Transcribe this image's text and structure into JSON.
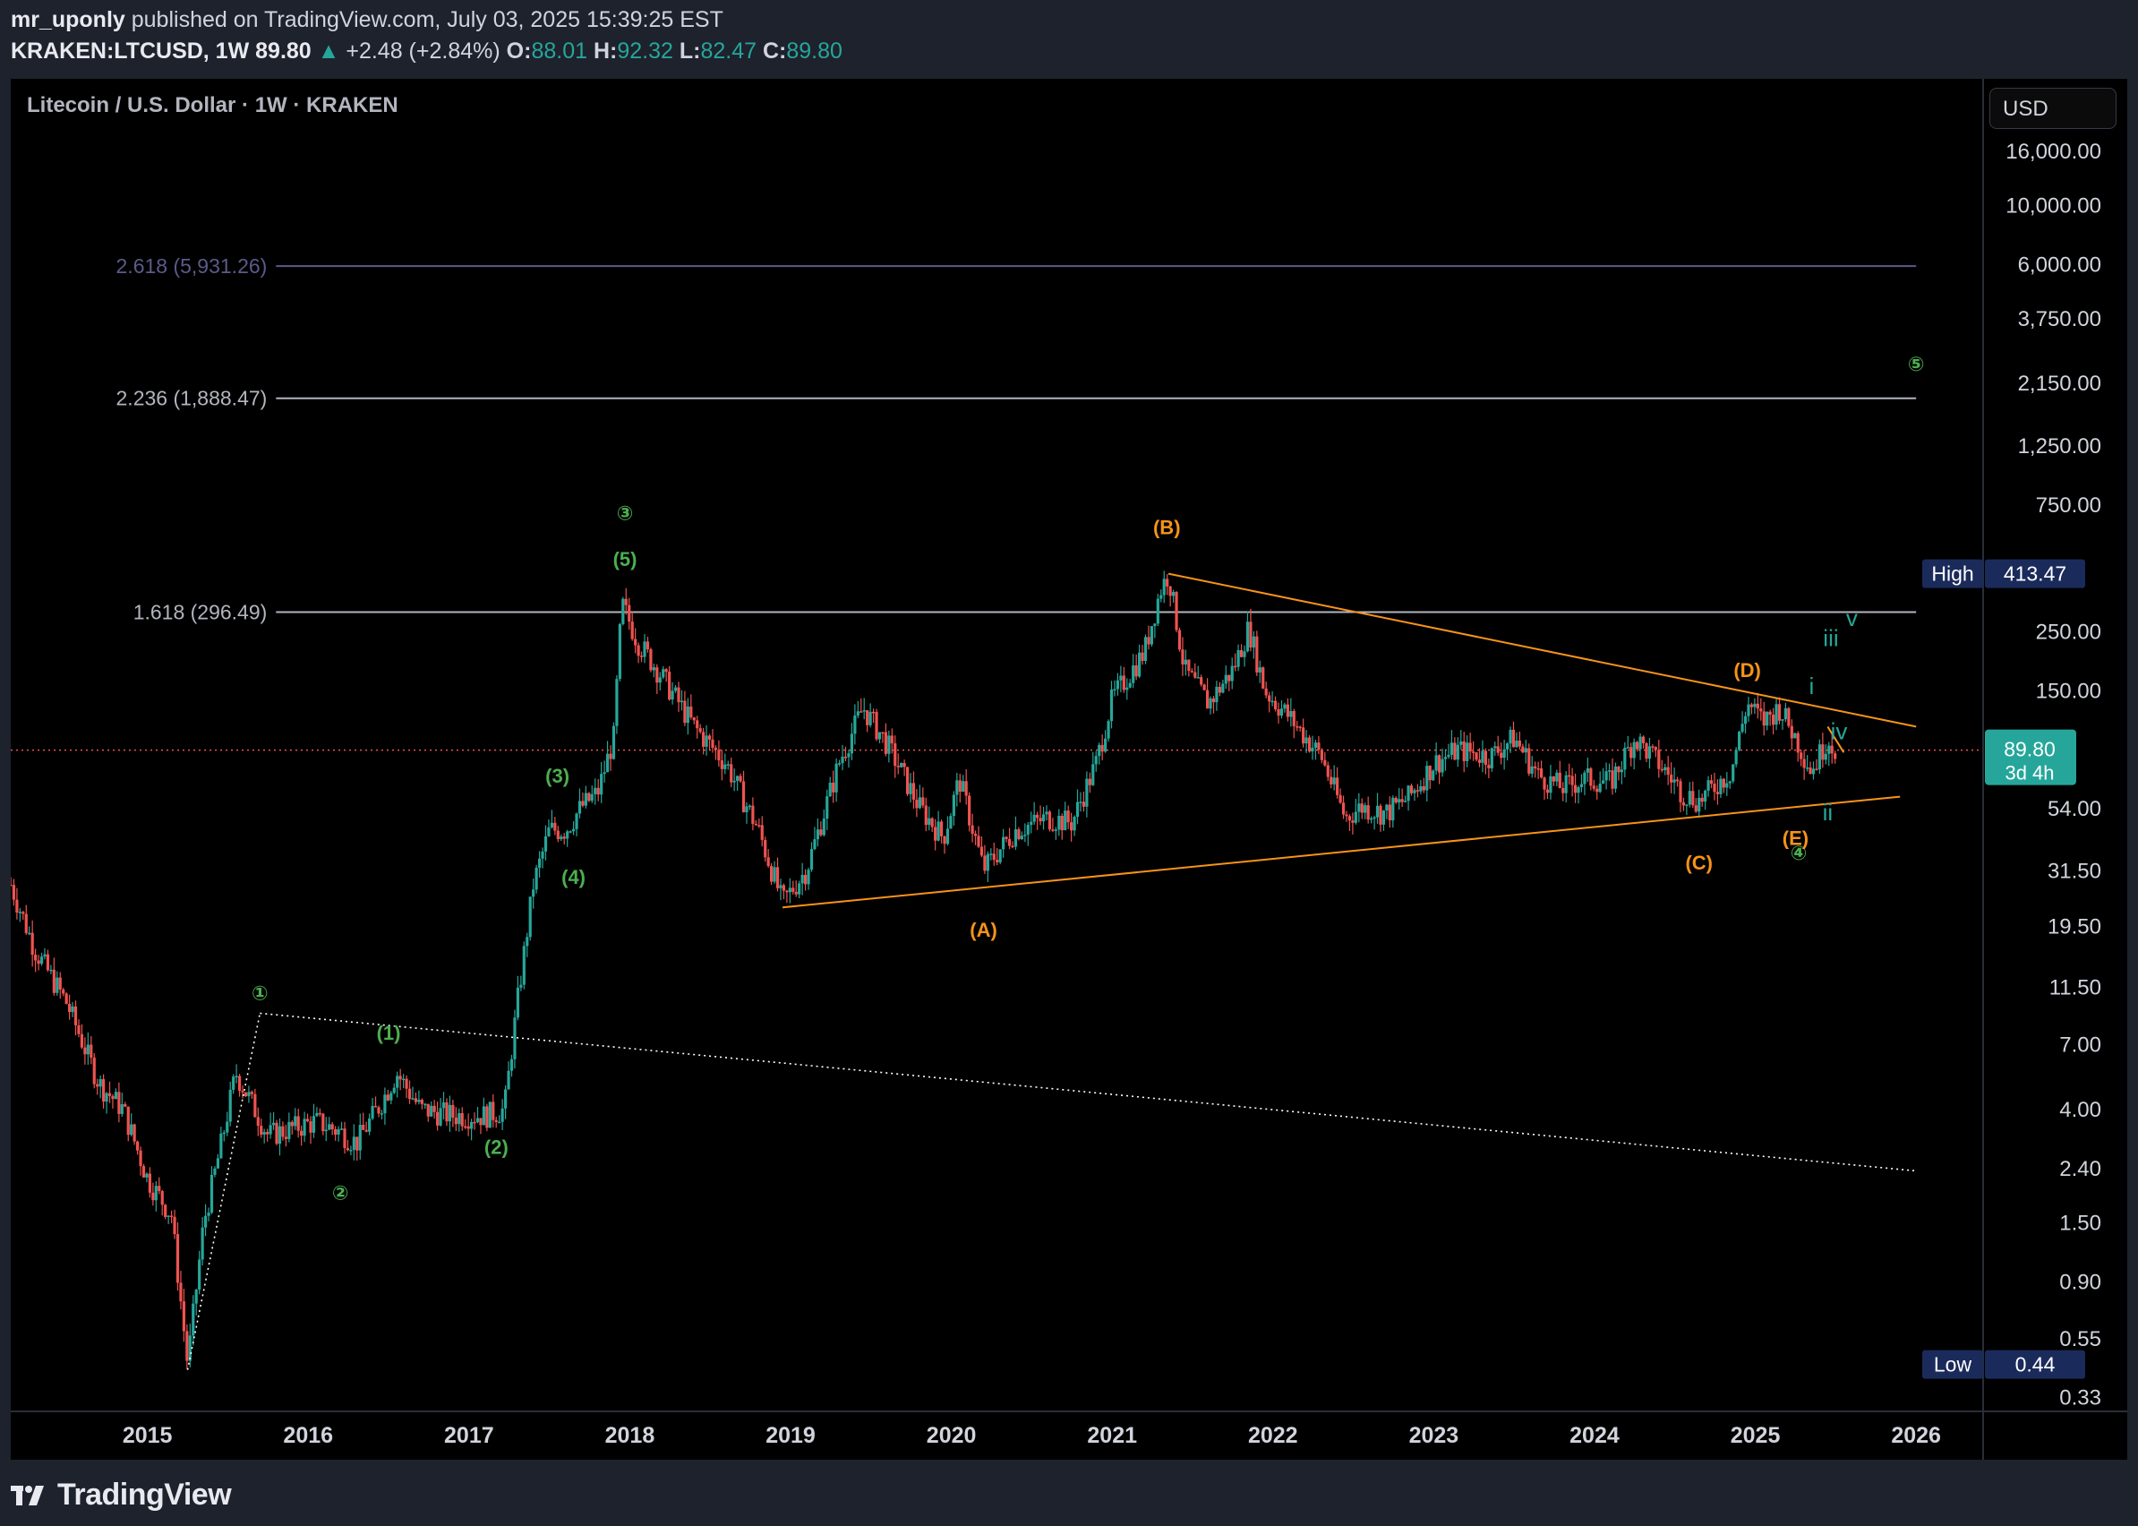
{
  "header": {
    "publisher": "mr_uponly",
    "published_text": "published on TradingView.com, July 03, 2025 15:39:25 EST",
    "symbol": "KRAKEN:LTCUSD, 1W",
    "last": "89.80",
    "change": "+2.48 (+2.84%)",
    "o_label": "O:",
    "o_value": "88.01",
    "h_label": "H:",
    "h_value": "92.32",
    "l_label": "L:",
    "l_value": "82.47",
    "c_label": "C:",
    "c_value": "89.80"
  },
  "footer": {
    "brand": "TradingView"
  },
  "colors": {
    "up": "#26a69a",
    "down": "#ef5350",
    "triangle": "#f7931a",
    "wave_green": "#4caf50",
    "roman_teal": "#26a69a",
    "fib_top": "#5b5a8a",
    "fib": "#b2b5be"
  },
  "chart_data": {
    "type": "candlestick",
    "title": "Litecoin / U.S. Dollar · 1W · KRAKEN",
    "currency": "USD",
    "scale": "log",
    "ylim": [
      0.3,
      22000
    ],
    "xlim": [
      2014.15,
      2026.4
    ],
    "y_ticks": [
      "16,000.00",
      "10,000.00",
      "6,000.00",
      "3,750.00",
      "2,150.00",
      "1,250.00",
      "750.00",
      "250.00",
      "150.00",
      "54.00",
      "31.50",
      "19.50",
      "11.50",
      "7.00",
      "4.00",
      "2.40",
      "1.50",
      "0.90",
      "0.55",
      "0.33"
    ],
    "x_ticks": [
      "2015",
      "2016",
      "2017",
      "2018",
      "2019",
      "2020",
      "2021",
      "2022",
      "2023",
      "2024",
      "2025",
      "2026"
    ],
    "price_series": {
      "name": "KRAKEN:LTCUSD",
      "points": [
        [
          2014.15,
          28
        ],
        [
          2014.3,
          16
        ],
        [
          2014.5,
          10
        ],
        [
          2014.7,
          5
        ],
        [
          2014.85,
          4.0
        ],
        [
          2015.0,
          2.2
        ],
        [
          2015.15,
          1.6
        ],
        [
          2015.25,
          0.44
        ],
        [
          2015.35,
          1.5
        ],
        [
          2015.45,
          2.8
        ],
        [
          2015.55,
          5.5
        ],
        [
          2015.65,
          4.2
        ],
        [
          2015.75,
          3.2
        ],
        [
          2015.9,
          3.4
        ],
        [
          2016.05,
          3.6
        ],
        [
          2016.2,
          3.3
        ],
        [
          2016.3,
          3.0
        ],
        [
          2016.45,
          4.2
        ],
        [
          2016.55,
          5.5
        ],
        [
          2016.7,
          4.0
        ],
        [
          2016.9,
          3.8
        ],
        [
          2017.1,
          3.8
        ],
        [
          2017.22,
          4.0
        ],
        [
          2017.3,
          10
        ],
        [
          2017.4,
          28
        ],
        [
          2017.5,
          45
        ],
        [
          2017.6,
          45
        ],
        [
          2017.7,
          55
        ],
        [
          2017.8,
          62
        ],
        [
          2017.9,
          100
        ],
        [
          2017.95,
          320
        ],
        [
          2018.05,
          230
        ],
        [
          2018.2,
          170
        ],
        [
          2018.4,
          110
        ],
        [
          2018.6,
          80
        ],
        [
          2018.8,
          45
        ],
        [
          2018.95,
          24
        ],
        [
          2019.1,
          32
        ],
        [
          2019.3,
          80
        ],
        [
          2019.45,
          130
        ],
        [
          2019.6,
          95
        ],
        [
          2019.8,
          55
        ],
        [
          2019.95,
          42
        ],
        [
          2020.05,
          70
        ],
        [
          2020.2,
          32
        ],
        [
          2020.4,
          45
        ],
        [
          2020.6,
          50
        ],
        [
          2020.75,
          48
        ],
        [
          2020.9,
          80
        ],
        [
          2021.0,
          140
        ],
        [
          2021.2,
          210
        ],
        [
          2021.3,
          360
        ],
        [
          2021.35,
          413.47
        ],
        [
          2021.45,
          180
        ],
        [
          2021.6,
          135
        ],
        [
          2021.75,
          180
        ],
        [
          2021.85,
          260
        ],
        [
          2021.95,
          150
        ],
        [
          2022.1,
          120
        ],
        [
          2022.3,
          85
        ],
        [
          2022.45,
          50
        ],
        [
          2022.55,
          55
        ],
        [
          2022.7,
          52
        ],
        [
          2022.85,
          60
        ],
        [
          2023.0,
          80
        ],
        [
          2023.15,
          90
        ],
        [
          2023.35,
          85
        ],
        [
          2023.5,
          100
        ],
        [
          2023.65,
          72
        ],
        [
          2023.8,
          65
        ],
        [
          2023.95,
          70
        ],
        [
          2024.1,
          68
        ],
        [
          2024.25,
          100
        ],
        [
          2024.4,
          80
        ],
        [
          2024.55,
          62
        ],
        [
          2024.65,
          58
        ],
        [
          2024.85,
          75
        ],
        [
          2024.95,
          135
        ],
        [
          2025.05,
          115
        ],
        [
          2025.15,
          130
        ],
        [
          2025.25,
          100
        ],
        [
          2025.35,
          75
        ],
        [
          2025.45,
          100
        ],
        [
          2025.5,
          89.8
        ]
      ]
    },
    "last_price": {
      "value": 89.8,
      "price_label": "89.80",
      "countdown": "3d 4h"
    },
    "high": {
      "label": "High",
      "value": 413.47,
      "text": "413.47"
    },
    "low": {
      "label": "Low",
      "value": 0.44,
      "text": "0.44"
    },
    "fib_levels": [
      {
        "label": "2.618 (5,931.26)",
        "value": 5931.26,
        "x_start": 2015.8,
        "x_end": 2026.0,
        "color": "#5b5a8a"
      },
      {
        "label": "2.236 (1,888.47)",
        "value": 1888.47,
        "x_start": 2015.8,
        "x_end": 2026.0,
        "color": "#b2b5be"
      },
      {
        "label": "1.618 (296.49)",
        "value": 296.49,
        "x_start": 2015.8,
        "x_end": 2026.0,
        "color": "#b2b5be"
      }
    ],
    "trendlines": [
      {
        "role": "triangle upper",
        "from": [
          2021.35,
          413.47
        ],
        "to": [
          2026.0,
          110
        ],
        "style": "solid",
        "color": "#f7931a"
      },
      {
        "role": "triangle lower",
        "from": [
          2018.95,
          23
        ],
        "to": [
          2025.9,
          60
        ],
        "style": "solid",
        "color": "#f7931a"
      },
      {
        "role": "dotted channel",
        "from": [
          2015.7,
          9.2
        ],
        "to": [
          2026.0,
          2.35
        ],
        "style": "dotted",
        "color": "#ffffff"
      },
      {
        "role": "dotted channel",
        "from": [
          2015.25,
          0.42
        ],
        "to": [
          2015.7,
          9.2
        ],
        "style": "dotted",
        "color": "#ffffff"
      },
      {
        "role": "wave v projection",
        "from": [
          2025.45,
          110
        ],
        "to": [
          2025.55,
          88
        ],
        "style": "solid",
        "color": "#f7931a"
      }
    ],
    "wave_labels": [
      {
        "text": "①",
        "x": 2015.7,
        "y": 11.0,
        "color": "#4caf50"
      },
      {
        "text": "②",
        "x": 2016.2,
        "y": 1.95,
        "color": "#4caf50"
      },
      {
        "text": "③",
        "x": 2017.97,
        "y": 700,
        "color": "#4caf50"
      },
      {
        "text": "④",
        "x": 2025.27,
        "y": 37,
        "color": "#4caf50"
      },
      {
        "text": "⑤",
        "x": 2026.0,
        "y": 2550,
        "color": "#4caf50"
      },
      {
        "text": "(1)",
        "x": 2016.5,
        "y": 7.8,
        "color": "#4caf50"
      },
      {
        "text": "(2)",
        "x": 2017.17,
        "y": 2.9,
        "color": "#4caf50"
      },
      {
        "text": "(3)",
        "x": 2017.55,
        "y": 72,
        "color": "#4caf50"
      },
      {
        "text": "(4)",
        "x": 2017.65,
        "y": 30,
        "color": "#4caf50"
      },
      {
        "text": "(5)",
        "x": 2017.97,
        "y": 470,
        "color": "#4caf50"
      },
      {
        "text": "(A)",
        "x": 2020.2,
        "y": 19.0,
        "color": "#f7931a"
      },
      {
        "text": "(B)",
        "x": 2021.34,
        "y": 620,
        "color": "#f7931a"
      },
      {
        "text": "(C)",
        "x": 2024.65,
        "y": 34,
        "color": "#f7931a"
      },
      {
        "text": "(D)",
        "x": 2024.95,
        "y": 180,
        "color": "#f7931a"
      },
      {
        "text": "(E)",
        "x": 2025.25,
        "y": 42,
        "color": "#f7931a"
      }
    ],
    "roman_labels": [
      {
        "text": "i",
        "x": 2025.35,
        "y": 155,
        "color": "#26a69a"
      },
      {
        "text": "ii",
        "x": 2025.45,
        "y": 52,
        "color": "#26a69a"
      },
      {
        "text": "iii",
        "x": 2025.47,
        "y": 235,
        "color": "#26a69a"
      },
      {
        "text": "iv",
        "x": 2025.52,
        "y": 105,
        "color": "#26a69a"
      },
      {
        "text": "v",
        "x": 2025.6,
        "y": 280,
        "color": "#26a69a"
      }
    ]
  }
}
